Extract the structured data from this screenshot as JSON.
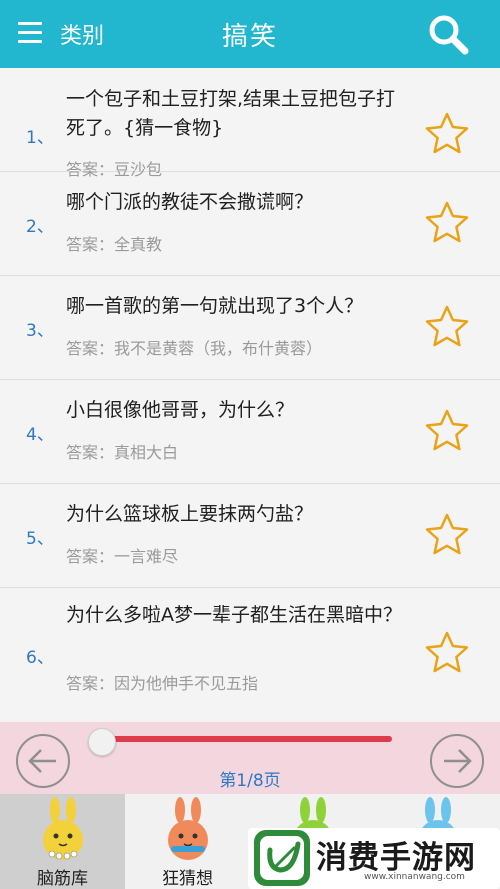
{
  "header": {
    "category_label": "类别",
    "title": "搞笑"
  },
  "items": [
    {
      "num": "1、",
      "question": "一个包子和土豆打架,结果土豆把包子打死了。{猜一食物}",
      "answer": "答案：豆沙包"
    },
    {
      "num": "2、",
      "question": "哪个门派的教徒不会撒谎啊？",
      "answer": "答案：全真教"
    },
    {
      "num": "3、",
      "question": "哪一首歌的第一句就出现了3个人？",
      "answer": "答案：我不是黄蓉（我，布什黄蓉）"
    },
    {
      "num": "4、",
      "question": "小白很像他哥哥，为什么？",
      "answer": "答案：真相大白"
    },
    {
      "num": "5、",
      "question": "为什么篮球板上要抹两勺盐？",
      "answer": "答案：一言难尽"
    },
    {
      "num": "6、",
      "question": "为什么多啦A梦一辈子都生活在黑暗中？",
      "answer": "答案：因为他伸手不见五指"
    }
  ],
  "pager": {
    "label": "第1/8页",
    "progress": 0.0
  },
  "tabs": [
    {
      "label": "脑筋库",
      "active": true
    },
    {
      "label": "狂猜想",
      "active": false
    },
    {
      "label": "",
      "active": false
    },
    {
      "label": "",
      "active": false
    }
  ],
  "watermark": {
    "text": "消费手游网",
    "url": "www.xinnanwang.com"
  },
  "colors": {
    "header_bg": "#23b6cf",
    "number_blue": "#2d79c4",
    "star_gold": "#e8a317",
    "slider_red": "#de3b4d",
    "pager_bg": "#f3d6de"
  }
}
